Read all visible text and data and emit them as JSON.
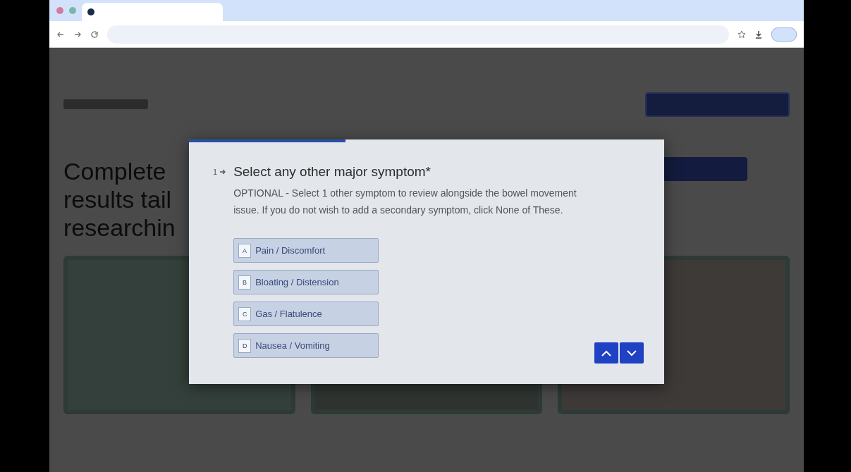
{
  "page": {
    "heading_lines": [
      "Complete",
      "results tail",
      "researchin"
    ]
  },
  "dialog": {
    "progress": {
      "level": 0.33
    },
    "question": {
      "number": "1",
      "title": "Select any other major symptom",
      "required_mark": "*",
      "description": "OPTIONAL - Select 1 other symptom to review alongside the bowel movement issue. If you do not wish to add a secondary symptom, click None of These."
    },
    "options": [
      {
        "key": "A",
        "label": "Pain / Discomfort",
        "selected": false
      },
      {
        "key": "B",
        "label": "Bloating / Distension",
        "selected": false
      },
      {
        "key": "C",
        "label": "Gas / Flatulence",
        "selected": false
      },
      {
        "key": "D",
        "label": "Nausea / Vomiting",
        "selected": false
      }
    ]
  }
}
